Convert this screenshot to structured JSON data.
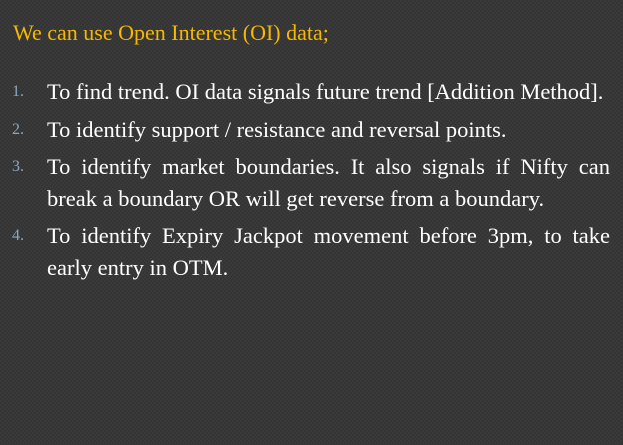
{
  "slide": {
    "title": "We can use Open Interest (OI) data;",
    "points": [
      {
        "number": "1.",
        "text": "To find trend. OI data signals future trend [Addition Method]."
      },
      {
        "number": "2.",
        "text": "To identify support / resistance and reversal points."
      },
      {
        "number": "3.",
        "text": "To identify market boundaries. It also signals if Nifty can break a boundary OR will get reverse from a boundary."
      },
      {
        "number": "4.",
        "text": "To identify Expiry Jackpot movement before 3pm, to take early entry in OTM."
      }
    ]
  },
  "colors": {
    "background": "#3a3a3a",
    "title": "#f6b800",
    "body_text": "#ffffff",
    "list_number": "#8aa9c0"
  }
}
